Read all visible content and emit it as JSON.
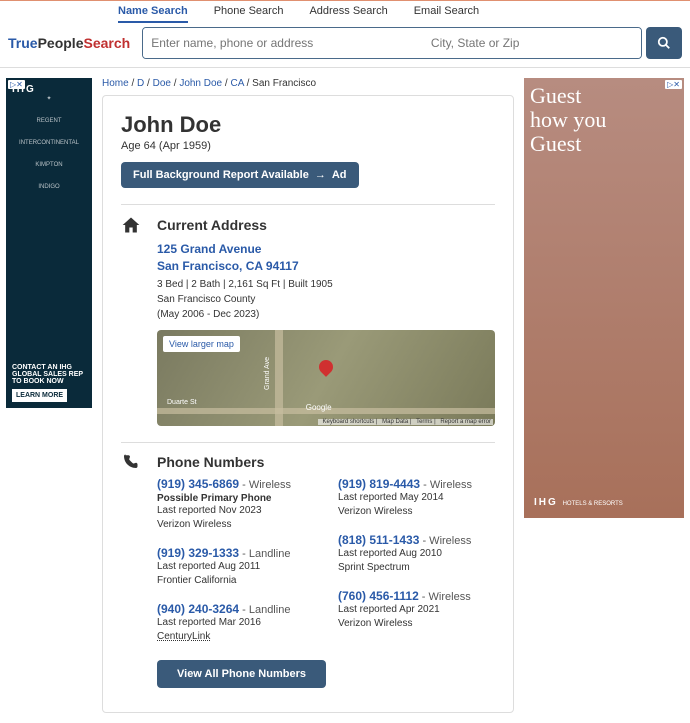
{
  "tabs": {
    "name": "Name Search",
    "phone": "Phone Search",
    "address": "Address Search",
    "email": "Email Search"
  },
  "search": {
    "placeholder1": "Enter name, phone or address",
    "placeholder2": "City, State or Zip"
  },
  "crumbs": {
    "home": "Home",
    "d": "D",
    "doe": "Doe",
    "jd": "John Doe",
    "ca": "CA",
    "sf": "San Francisco"
  },
  "person": {
    "name": "John Doe",
    "age": "Age 64 (Apr 1959)"
  },
  "bg_btn": {
    "label": "Full Background Report Available",
    "ad": "Ad"
  },
  "addr_section": {
    "title": "Current Address"
  },
  "addr": {
    "line1": "125 Grand Avenue",
    "line2": "San Francisco, CA 94117",
    "meta1": "3 Bed | 2 Bath | 2,161 Sq Ft | Built 1905",
    "meta2": "San Francisco County",
    "meta3": "(May 2006 - Dec 2023)"
  },
  "map": {
    "larger": "View larger map",
    "road_v": "Grand Ave",
    "road_h": "Duarte St",
    "google": "Google",
    "f1": "Keyboard shortcuts",
    "f2": "Map Data",
    "f3": "Terms",
    "f4": "Report a map error"
  },
  "phones_section": {
    "title": "Phone Numbers"
  },
  "phones": {
    "left": [
      {
        "num": "(919) 345-6869",
        "type": " - Wireless",
        "primary": "Possible Primary Phone",
        "r": "Last reported Nov 2023",
        "c": "Verizon Wireless"
      },
      {
        "num": "(919) 329-1333",
        "type": " - Landline",
        "r": "Last reported Aug 2011",
        "c": "Frontier California"
      },
      {
        "num": "(940) 240-3264",
        "type": " - Landline",
        "r": "Last reported Mar 2016",
        "c_red": "CenturyLink"
      }
    ],
    "right": [
      {
        "num": "(919) 819-4443",
        "type": " - Wireless",
        "r": "Last reported May 2014",
        "c": "Verizon Wireless"
      },
      {
        "num": "(818) 511-1433",
        "type": " - Wireless",
        "r": "Last reported Aug 2010",
        "c": "Sprint Spectrum"
      },
      {
        "num": "(760) 456-1112",
        "type": " - Wireless",
        "r": "Last reported Apr 2021",
        "c": "Verizon Wireless"
      }
    ]
  },
  "view_all": "View All Phone Numbers",
  "ad_left": {
    "logo": "IHG",
    "i1": "REGENT",
    "i2": "INTERCONTINENTAL",
    "i3": "KIMPTON",
    "i4": "INDIGO",
    "cta": "CONTACT AN IHG GLOBAL SALES REP TO BOOK NOW",
    "btn": "LEARN MORE"
  },
  "ad_right": {
    "l1": "Guest",
    "l2": "how you",
    "l3": "Guest",
    "brand": "IHG",
    "sub": "HOTELS & RESORTS"
  }
}
